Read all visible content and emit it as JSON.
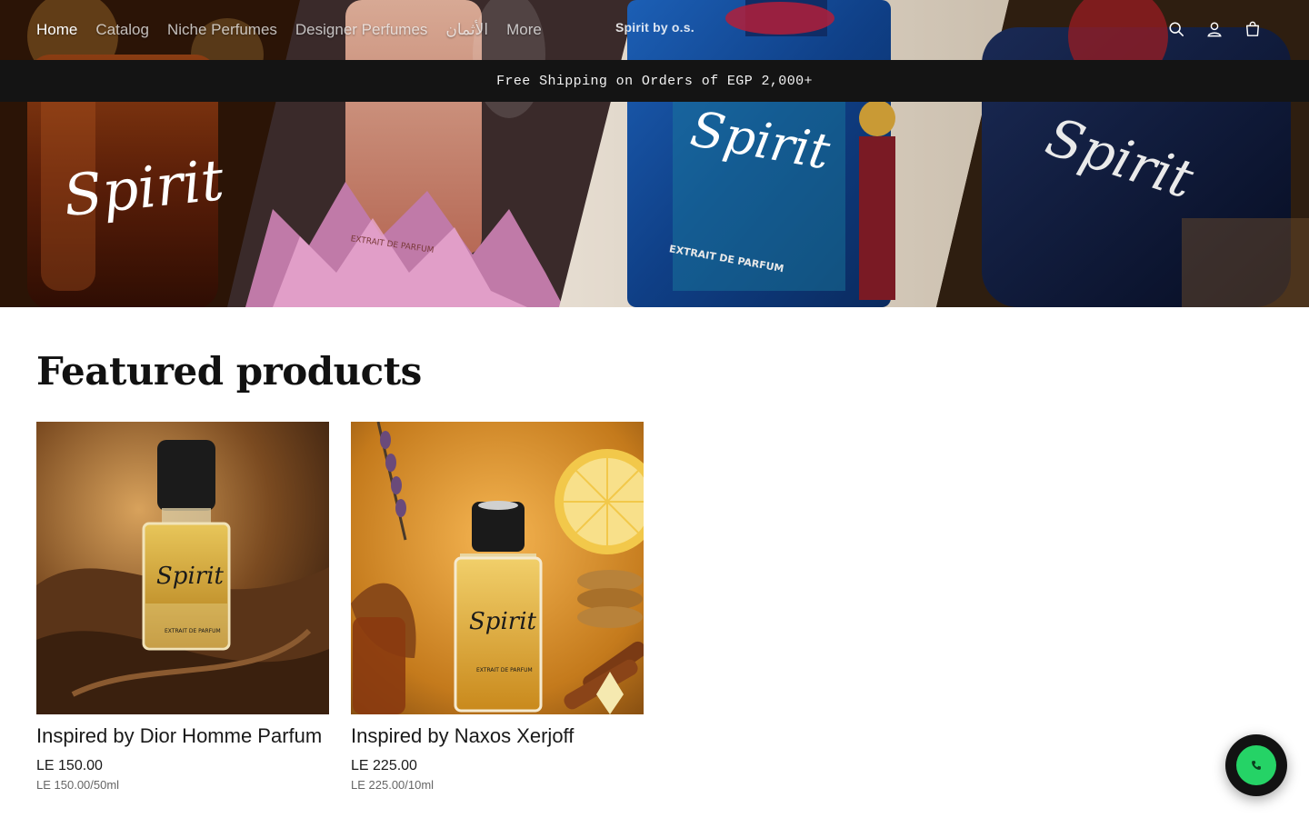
{
  "header": {
    "nav": [
      {
        "label": "Home",
        "active": true
      },
      {
        "label": "Catalog",
        "active": false
      },
      {
        "label": "Niche Perfumes",
        "active": false
      },
      {
        "label": "Designer Perfumes",
        "active": false
      },
      {
        "label": "الأثمان",
        "active": false
      },
      {
        "label": "More",
        "active": false
      }
    ],
    "logo": "Spirit by o.s.",
    "icons": [
      "search-icon",
      "account-icon",
      "cart-icon"
    ]
  },
  "announcement": {
    "text": "Free Shipping on Orders of EGP 2,000+"
  },
  "hero": {
    "bottle_labels": [
      "Spirit",
      "Spirit",
      "Spirit",
      "Spirit"
    ],
    "sub_labels": [
      "EXTRAIT DE PARFUM",
      "EXTRAIT DE PARFUM"
    ]
  },
  "featured": {
    "title": "Featured products",
    "products": [
      {
        "title": "Inspired by Dior Homme Parfum",
        "price": "LE 150.00",
        "unit_price": "LE 150.00/50ml",
        "bottle_label": "Spirit",
        "bottle_sub": "EXTRAIT DE PARFUM"
      },
      {
        "title": "Inspired by Naxos Xerjoff",
        "price": "LE 225.00",
        "unit_price": "LE 225.00/10ml",
        "bottle_label": "Spirit",
        "bottle_sub": "EXTRAIT DE PARFUM"
      }
    ]
  },
  "chat": {
    "icon": "phone-icon",
    "color": "#25d366"
  },
  "colors": {
    "announcement_bg": "#141414",
    "text": "#111111"
  }
}
